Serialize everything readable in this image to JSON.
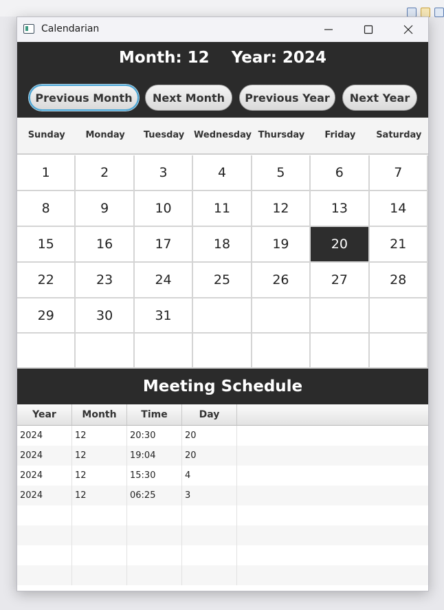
{
  "window": {
    "title": "Calendarian"
  },
  "header": {
    "month_label": "Month: 12",
    "year_label": "Year: 2024"
  },
  "nav": {
    "prev_month": "Previous Month",
    "next_month": "Next Month",
    "prev_year": "Previous Year",
    "next_year": "Next Year"
  },
  "weekdays": [
    "Sunday",
    "Monday",
    "Tuesday",
    "Wednesday",
    "Thursday",
    "Friday",
    "Saturday"
  ],
  "calendar": {
    "selected_day": "20",
    "weeks": [
      [
        "1",
        "2",
        "3",
        "4",
        "5",
        "6",
        "7"
      ],
      [
        "8",
        "9",
        "10",
        "11",
        "12",
        "13",
        "14"
      ],
      [
        "15",
        "16",
        "17",
        "18",
        "19",
        "20",
        "21"
      ],
      [
        "22",
        "23",
        "24",
        "25",
        "26",
        "27",
        "28"
      ],
      [
        "29",
        "30",
        "31",
        "",
        "",
        "",
        ""
      ],
      [
        "",
        "",
        "",
        "",
        "",
        "",
        ""
      ]
    ]
  },
  "meetings": {
    "title": "Meeting Schedule",
    "columns": [
      "Year",
      "Month",
      "Time",
      "Day"
    ],
    "rows": [
      [
        "2024",
        "12",
        "20:30",
        "20"
      ],
      [
        "2024",
        "12",
        "19:04",
        "20"
      ],
      [
        "2024",
        "12",
        "15:30",
        "4"
      ],
      [
        "2024",
        "12",
        "06:25",
        "3"
      ]
    ]
  }
}
